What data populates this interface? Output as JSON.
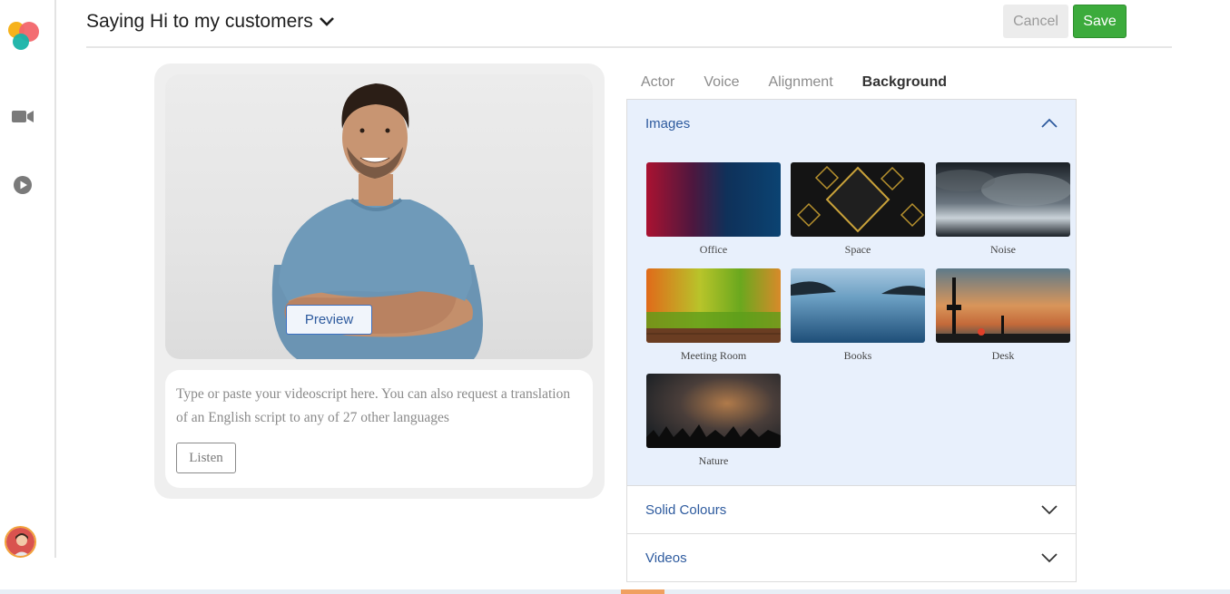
{
  "app": {
    "title": "Saying Hi to my customers",
    "cancel_label": "Cancel",
    "save_label": "Save"
  },
  "sidebar": {
    "items": [
      {
        "icon": "video-camera-icon"
      },
      {
        "icon": "play-circle-icon"
      }
    ],
    "avatar": "avatar"
  },
  "editor": {
    "preview_label": "Preview",
    "script_placeholder": "Type or paste your videoscript here. You can also request a translation of an English script to any of 27 other languages",
    "listen_label": "Listen"
  },
  "tabs": [
    {
      "label": "Actor"
    },
    {
      "label": "Voice"
    },
    {
      "label": "Alignment"
    },
    {
      "label": "Background",
      "active": true
    }
  ],
  "background": {
    "images_label": "Images",
    "images": [
      {
        "name": "Office"
      },
      {
        "name": "Space"
      },
      {
        "name": "Noise"
      },
      {
        "name": "Meeting Room"
      },
      {
        "name": "Books"
      },
      {
        "name": "Desk"
      },
      {
        "name": "Nature"
      }
    ],
    "solid_colours_label": "Solid Colours",
    "videos_label": "Videos"
  },
  "colors": {
    "accent": "#2d5a9e",
    "save": "#3cab3c",
    "panel_bg": "#e8f0fc"
  }
}
